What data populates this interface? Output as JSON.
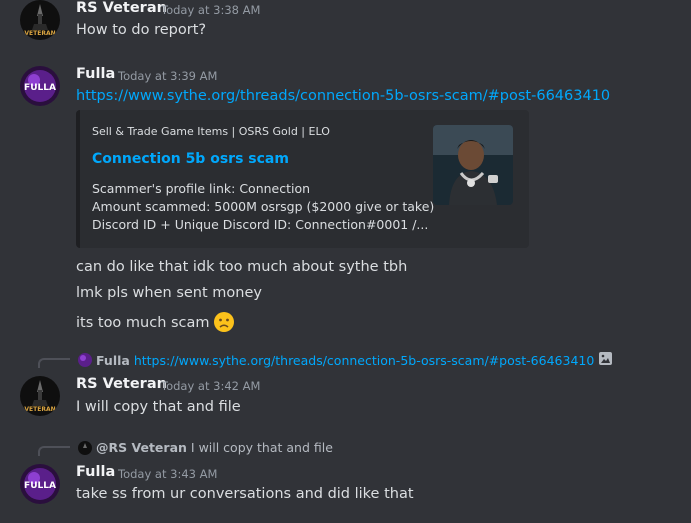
{
  "colors": {
    "background": "#313338",
    "link": "#00a8fc",
    "timestamp": "#949ba4",
    "username": "#f2f3f5",
    "embed_bg": "#2b2d31"
  },
  "messages": [
    {
      "author": "RS Veteran",
      "timestamp": "Today at 3:38 AM",
      "avatar_icon": "rs-veteran-avatar-icon",
      "avatar_text": "VETERAN",
      "text": "How to do report?"
    },
    {
      "author": "Fulla",
      "timestamp": "Today at 3:39 AM",
      "avatar_icon": "fulla-avatar-icon",
      "avatar_text": "FULLA",
      "link": "https://www.sythe.org/threads/connection-5b-osrs-scam/#post-66463410",
      "embed": {
        "provider": "Sell & Trade Game Items | OSRS Gold | ELO",
        "title": "Connection 5b osrs scam",
        "description": [
          "Scammer's profile link: Connection",
          "Amount scammed: 5000M osrsgp ($2000 give or take)",
          "Discord ID + Unique Discord ID: Connection#0001 /..."
        ],
        "thumbnail_icon": "person-thumbnail-icon"
      },
      "followups": [
        "can do like that idk too much about sythe tbh",
        "lmk pls when sent money",
        "its too much scam"
      ],
      "followup_emoji": "worried-face-emoji"
    },
    {
      "reply_to": {
        "author": "Fulla",
        "text": "https://www.sythe.org/threads/connection-5b-osrs-scam/#post-66463410",
        "attachment_icon": "image-icon"
      },
      "author": "RS Veteran",
      "timestamp": "Today at 3:42 AM",
      "avatar_icon": "rs-veteran-avatar-icon",
      "avatar_text": "VETERAN",
      "text": "I will copy that and file"
    },
    {
      "reply_to": {
        "author": "@RS Veteran",
        "text": "I will copy that and file"
      },
      "author": "Fulla",
      "timestamp": "Today at 3:43 AM",
      "avatar_icon": "fulla-avatar-icon",
      "avatar_text": "FULLA",
      "text": "take ss from ur conversations and did like that"
    }
  ]
}
